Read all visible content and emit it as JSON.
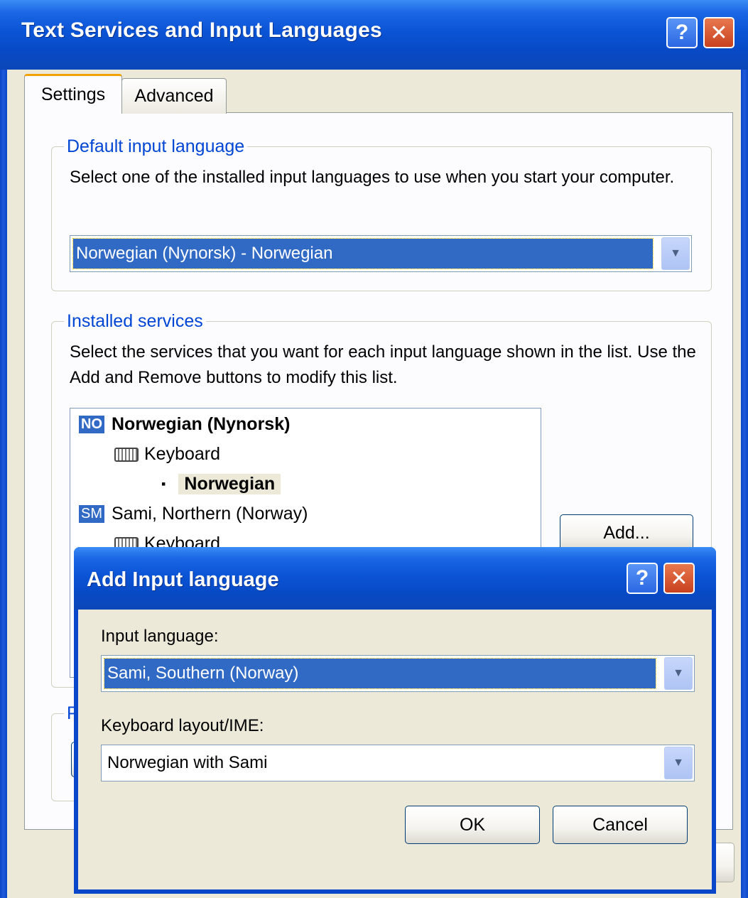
{
  "main_window": {
    "title": "Text Services and Input Languages",
    "help_label": "?",
    "close_label": "✕",
    "tabs": [
      {
        "label": "Settings"
      },
      {
        "label": "Advanced"
      }
    ],
    "default_input_language": {
      "legend": "Default input language",
      "description": "Select one of the installed input languages to use when you start your computer.",
      "selected": "Norwegian (Nynorsk) - Norwegian"
    },
    "installed_services": {
      "legend": "Installed services",
      "description": "Select the services that you want for each input language shown in the list. Use the Add and Remove buttons to modify this list.",
      "tree": [
        {
          "badge": "NO",
          "label": "Norwegian (Nynorsk)"
        },
        {
          "label": "Keyboard"
        },
        {
          "bullet": "▪",
          "label": "Norwegian"
        },
        {
          "badge": "SM",
          "label": "Sami, Northern (Norway)"
        },
        {
          "label": "Keyboard"
        }
      ],
      "add_button": "Add..."
    },
    "partial_group_letter": "P"
  },
  "add_dialog": {
    "title": "Add Input language",
    "help_label": "?",
    "close_label": "✕",
    "input_language_label": "Input language:",
    "input_language_value": "Sami, Southern (Norway)",
    "keyboard_layout_label": "Keyboard layout/IME:",
    "keyboard_layout_value": "Norwegian with Sami",
    "ok_label": "OK",
    "cancel_label": "Cancel"
  },
  "colors": {
    "titlebar": "#0a54d6",
    "dialog_bg": "#ece9d8",
    "selection": "#316ac5",
    "group_legend": "#0046d5"
  }
}
